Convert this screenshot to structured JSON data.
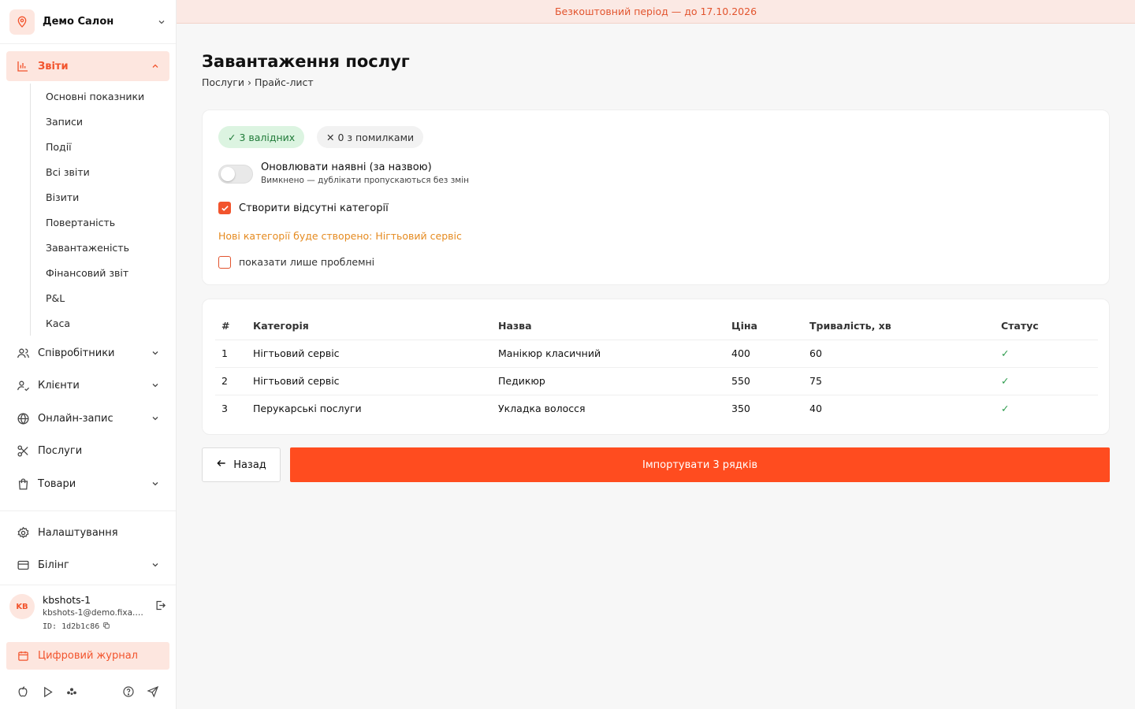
{
  "sidebar": {
    "salon_name": "Демо Салон",
    "active_section": "Звіти",
    "reports_sub": [
      "Основні показники",
      "Записи",
      "Події",
      "Всі звіти",
      "Візити",
      "Повертаність",
      "Завантаженість",
      "Фінансовий звіт",
      "P&L",
      "Каса"
    ],
    "staff": "Співробітники",
    "clients": "Клієнти",
    "online": "Онлайн-запис",
    "services": "Послуги",
    "products": "Товари",
    "settings": "Налаштування",
    "billing": "Білінг",
    "journal": "Цифровий журнал",
    "accent": "#f2542d"
  },
  "user": {
    "initials": "KB",
    "name": "kbshots-1",
    "email": "kbshots-1@demo.fixa.b...",
    "id": "ID: 1d2b1c86"
  },
  "banner": "Безкоштовний період — до 17.10.2026",
  "page": {
    "title": "Завантаження послуг",
    "breadcrumb": "Послуги › Прайс-лист"
  },
  "options": {
    "valid_pill": "✓ 3 валідних",
    "error_pill": "✕ 0 з помилками",
    "update_label": "Оновлювати наявні (за назвою)",
    "update_hint": "Вимкнено — дублікати пропускаються без змін",
    "update_enabled": false,
    "create_categories_label": "Створити відсутні категорії",
    "create_categories_checked": true,
    "new_categories_notice": "Нові категорії буде створено: Нігтьовий сервіс",
    "only_problems_label": "показати лише проблемні",
    "only_problems_checked": false
  },
  "table": {
    "headers": [
      "#",
      "Категорія",
      "Назва",
      "Ціна",
      "Тривалість, хв",
      "Статус"
    ],
    "rows": [
      [
        "1",
        "Нігтьовий сервіс",
        "Манікюр класичний",
        "400",
        "60",
        "✓"
      ],
      [
        "2",
        "Нігтьовий сервіс",
        "Педикюр",
        "550",
        "75",
        "✓"
      ],
      [
        "3",
        "Перукарські послуги",
        "Укладка волосся",
        "350",
        "40",
        "✓"
      ]
    ]
  },
  "actions": {
    "back": "Назад",
    "import": "Імпортувати 3 рядків"
  }
}
